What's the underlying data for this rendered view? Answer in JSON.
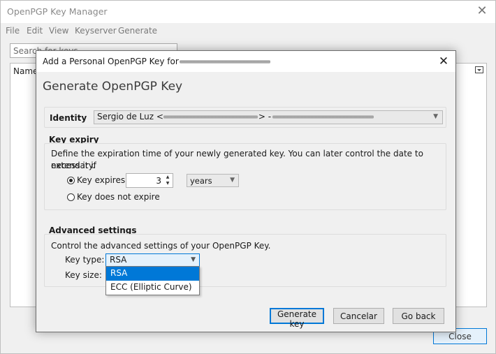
{
  "main_window": {
    "title": "OpenPGP Key Manager",
    "menu": [
      "File",
      "Edit",
      "View",
      "Keyserver",
      "Generate"
    ],
    "search_placeholder": "Search for keys",
    "column_header": "Name",
    "close_button": "Close"
  },
  "dialog": {
    "title": "Add a Personal OpenPGP Key for",
    "heading": "Generate OpenPGP Key",
    "identity": {
      "label": "Identity",
      "value_name": "Sergio de Luz <",
      "value_sep": "> -"
    },
    "expiry": {
      "title": "Key expiry",
      "description_line1": "Define the expiration time of your newly generated key. You can later control the date to extend it if",
      "description_line2": "necessary.",
      "option_expires": "Key expires in",
      "option_never": "Key does not expire",
      "amount": "3",
      "unit": "years",
      "expires_selected": true
    },
    "advanced": {
      "title": "Advanced settings",
      "description": "Control the advanced settings of your OpenPGP Key.",
      "key_type_label": "Key type:",
      "key_size_label": "Key size:",
      "key_type_value": "RSA",
      "key_type_options": [
        "RSA",
        "ECC (Elliptic Curve)"
      ]
    },
    "buttons": {
      "generate": "Generate key",
      "cancel": "Cancelar",
      "back": "Go back"
    }
  },
  "colors": {
    "accent": "#0078d7",
    "dialog_bg": "#f0f0f0",
    "selection": "#0078d7"
  }
}
